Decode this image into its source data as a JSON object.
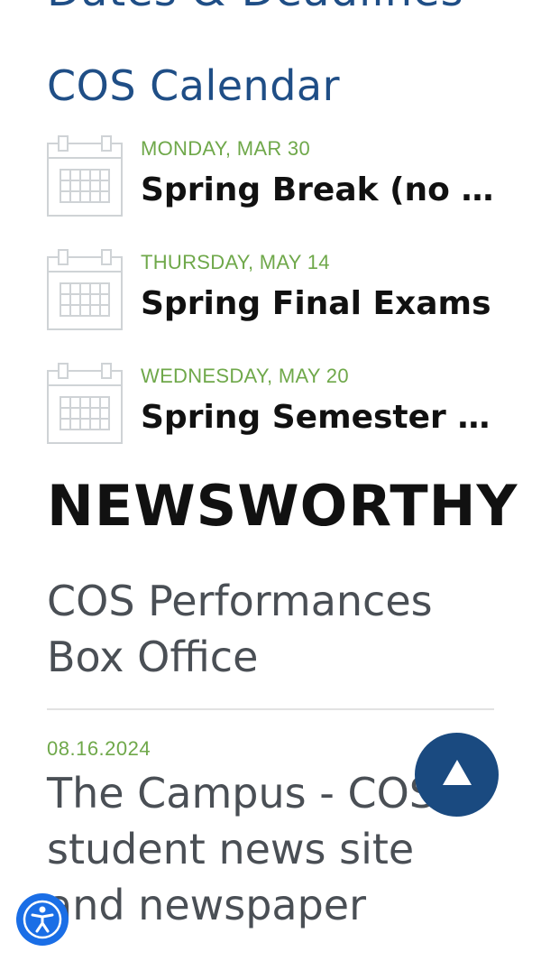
{
  "partial_heading": "Dates & Deadlines",
  "calendar": {
    "title": "COS Calendar",
    "events": [
      {
        "date": "MONDAY, MAR 30",
        "title": "Spring Break (no classes)"
      },
      {
        "date": "THURSDAY, MAY 14",
        "title": "Spring Final Exams"
      },
      {
        "date": "WEDNESDAY, MAY 20",
        "title": "Spring Semester Ends"
      }
    ]
  },
  "newsworthy": {
    "heading": "NEWSWORTHY",
    "items": [
      {
        "title": "COS Performances Box Office"
      },
      {
        "date": "08.16.2024",
        "title": "The Campus - COS student news site and newspaper"
      }
    ]
  },
  "icons": {
    "calendar": "calendar-icon",
    "scroll_top": "arrow-up-icon",
    "accessibility": "accessibility-icon"
  },
  "colors": {
    "brand_blue": "#1f4e86",
    "accent_green": "#6fa84a",
    "scroll_button": "#1a4a80",
    "accessibility_button": "#1a6ee6"
  }
}
